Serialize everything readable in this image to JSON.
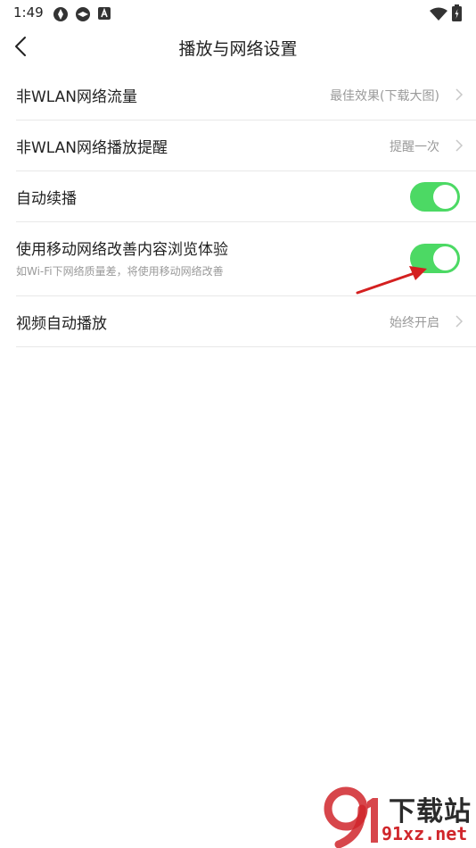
{
  "status_bar": {
    "time": "1:49",
    "icons": [
      "app-icon",
      "app-icon",
      "notification-a-icon",
      "wifi-icon",
      "battery-charging-icon"
    ]
  },
  "header": {
    "title": "播放与网络设置",
    "back_icon": "chevron-left-icon"
  },
  "settings": {
    "mobile_data": {
      "label": "非WLAN网络流量",
      "value": "最佳效果(下载大图)"
    },
    "mobile_play_reminder": {
      "label": "非WLAN网络播放提醒",
      "value": "提醒一次"
    },
    "autoplay_next": {
      "label": "自动续播",
      "enabled": true
    },
    "mobile_enhance": {
      "label": "使用移动网络改善内容浏览体验",
      "description": "如Wi-Fi下网络质量差，将使用移动网络改善",
      "enabled": true
    },
    "video_autoplay": {
      "label": "视频自动播放",
      "value": "始终开启"
    }
  },
  "colors": {
    "toggle_on": "#4cd964",
    "annotation_arrow": "#d42020",
    "watermark_red": "#d0262b"
  },
  "watermark": {
    "brand": "下载站",
    "site": "91xz.net"
  }
}
